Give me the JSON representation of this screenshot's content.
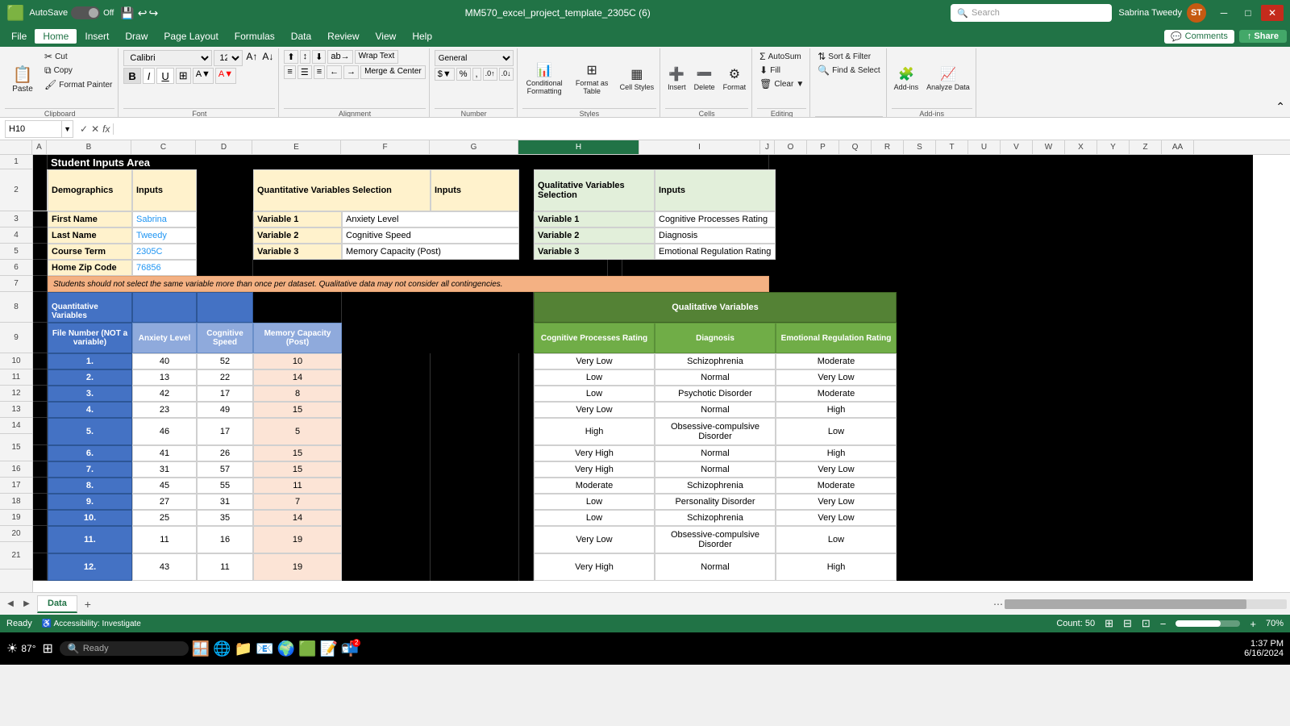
{
  "titlebar": {
    "app": "Excel",
    "autosave_label": "AutoSave",
    "autosave_state": "Off",
    "filename": "MM570_excel_project_template_2305C (6)",
    "search_placeholder": "Search",
    "user_name": "Sabrina Tweedy",
    "user_initials": "ST"
  },
  "menubar": {
    "items": [
      "File",
      "Home",
      "Insert",
      "Draw",
      "Page Layout",
      "Formulas",
      "Data",
      "Review",
      "View",
      "Help"
    ],
    "active": "Home",
    "comments_label": "Comments",
    "share_label": "Share"
  },
  "ribbon": {
    "clipboard": {
      "label": "Clipboard",
      "paste_label": "Paste",
      "cut_label": "Cut",
      "copy_label": "Copy",
      "format_painter_label": "Format Painter"
    },
    "font": {
      "label": "Font",
      "font_name": "Calibri",
      "font_size": "12"
    },
    "alignment": {
      "label": "Alignment",
      "wrap_text": "Wrap Text",
      "merge_center": "Merge & Center"
    },
    "number": {
      "label": "Number"
    },
    "styles": {
      "label": "Styles",
      "conditional_formatting": "Conditional Formatting",
      "format_as_table": "Format as Table",
      "cell_styles": "Cell Styles"
    },
    "cells": {
      "label": "Cells",
      "insert": "Insert",
      "delete": "Delete",
      "format": "Format"
    },
    "editing": {
      "label": "Editing",
      "autosum": "AutoSum",
      "fill": "Fill",
      "clear": "Clear",
      "sort_filter": "Sort & Filter",
      "find_select": "Find & Select"
    },
    "addins": {
      "label": "Add-ins",
      "addins": "Add-ins",
      "analyze_data": "Analyze Data"
    }
  },
  "formulabar": {
    "cell_ref": "H10",
    "formula": ""
  },
  "columns": [
    "B",
    "C",
    "D",
    "E",
    "F",
    "G",
    "H",
    "I",
    "J",
    "O",
    "P",
    "Q",
    "R",
    "S",
    "T",
    "U",
    "V",
    "W",
    "X",
    "Y",
    "Z",
    "AA"
  ],
  "spreadsheet": {
    "title": "Student Inputs Area",
    "warning": "Students should not select the same variable more than once per dataset. Qualitative data may not consider all contingencies.",
    "demo_header": "Demographics",
    "inputs_header": "Inputs",
    "quant_header": "Quantitative Variables Selection",
    "quant_inputs_header": "Inputs",
    "qual_header": "Qualitative Variables Selection",
    "qual_inputs_header": "Inputs",
    "rows": [
      {
        "num": 3,
        "label": "First Name",
        "value": "Sabrina",
        "v1": "Variable 1",
        "v1val": "Anxiety Level",
        "qv1": "Variable 1",
        "qv1val": "Cognitive Processes Rating"
      },
      {
        "num": 4,
        "label": "Last Name",
        "value": "Tweedy",
        "v2": "Variable 2",
        "v2val": "Cognitive Speed",
        "qv2": "Variable 2",
        "qv2val": "Diagnosis"
      },
      {
        "num": 5,
        "label": "Course Term",
        "value": "2305C",
        "v3": "Variable 3",
        "v3val": "Memory Capacity (Post)",
        "qv3": "Variable 3",
        "qv3val": "Emotional Regulation Rating"
      },
      {
        "num": 6,
        "label": "Home Zip Code",
        "value": "76856"
      }
    ],
    "data_header_quant": "Quantitative Variables",
    "data_header_qual": "Qualitative Variables",
    "col_headers": {
      "file_num": "File Number (NOT a variable)",
      "anxiety": "Anxiety Level",
      "cog_speed": "Cognitive Speed",
      "memory": "Memory Capacity (Post)",
      "cog_processes": "Cognitive Processes Rating",
      "diagnosis": "Diagnosis",
      "emotional_reg": "Emotional Regulation Rating"
    },
    "data_rows": [
      {
        "num": "1.",
        "anxiety": 40,
        "cog_speed": 52,
        "memory": 10,
        "cog_proc": "Very Low",
        "diagnosis": "Schizophrenia",
        "emotional_reg": "Moderate"
      },
      {
        "num": "2.",
        "anxiety": 13,
        "cog_speed": 22,
        "memory": 14,
        "cog_proc": "Low",
        "diagnosis": "Normal",
        "emotional_reg": "Very Low"
      },
      {
        "num": "3.",
        "anxiety": 42,
        "cog_speed": 17,
        "memory": 8,
        "cog_proc": "Low",
        "diagnosis": "Psychotic Disorder",
        "emotional_reg": "Moderate"
      },
      {
        "num": "4.",
        "anxiety": 23,
        "cog_speed": 49,
        "memory": 15,
        "cog_proc": "Very Low",
        "diagnosis": "Normal",
        "emotional_reg": "High"
      },
      {
        "num": "5.",
        "anxiety": 46,
        "cog_speed": 17,
        "memory": 5,
        "cog_proc": "High",
        "diagnosis": "Obsessive-compulsive Disorder",
        "emotional_reg": "Low"
      },
      {
        "num": "6.",
        "anxiety": 41,
        "cog_speed": 26,
        "memory": 15,
        "cog_proc": "Very High",
        "diagnosis": "Normal",
        "emotional_reg": "High"
      },
      {
        "num": "7.",
        "anxiety": 31,
        "cog_speed": 57,
        "memory": 15,
        "cog_proc": "Very High",
        "diagnosis": "Normal",
        "emotional_reg": "Very Low"
      },
      {
        "num": "8.",
        "anxiety": 45,
        "cog_speed": 55,
        "memory": 11,
        "cog_proc": "Moderate",
        "diagnosis": "Schizophrenia",
        "emotional_reg": "Moderate"
      },
      {
        "num": "9.",
        "anxiety": 27,
        "cog_speed": 31,
        "memory": 7,
        "cog_proc": "Low",
        "diagnosis": "Personality Disorder",
        "emotional_reg": "Very Low"
      },
      {
        "num": "10.",
        "anxiety": 25,
        "cog_speed": 35,
        "memory": 14,
        "cog_proc": "Low",
        "diagnosis": "Schizophrenia",
        "emotional_reg": "Very Low"
      },
      {
        "num": "11.",
        "anxiety": 11,
        "cog_speed": 16,
        "memory": 19,
        "cog_proc": "Very Low",
        "diagnosis": "Obsessive-compulsive Disorder",
        "emotional_reg": "Low"
      },
      {
        "num": "12.",
        "anxiety": 43,
        "cog_speed": 11,
        "memory": 19,
        "cog_proc": "Very High",
        "diagnosis": "Normal",
        "emotional_reg": "High"
      }
    ]
  },
  "sheet_tabs": [
    "Data"
  ],
  "statusbar": {
    "ready": "Ready",
    "accessibility": "Accessibility: Investigate",
    "count": "Count: 50",
    "zoom": "70%"
  },
  "taskbar": {
    "time": "1:37 PM",
    "date": "6/16/2024",
    "temp": "87°",
    "weather_icon": "☀"
  }
}
